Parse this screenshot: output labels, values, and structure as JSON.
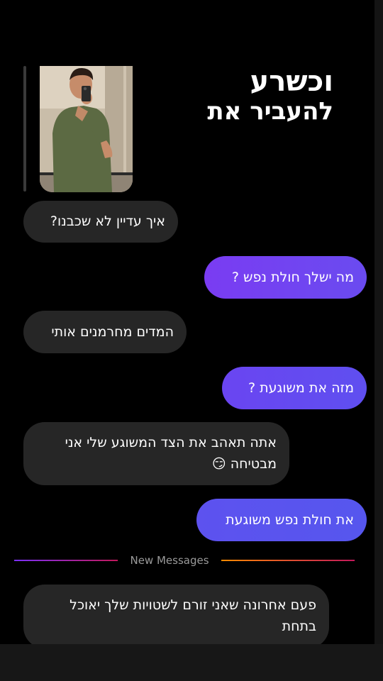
{
  "story": {
    "caption_line1": "וכשרע",
    "caption_line2": "להעביר את"
  },
  "messages": [
    {
      "direction": "incoming",
      "text": "איך עדיין לא שכבנו?"
    },
    {
      "direction": "outgoing",
      "text": "מה ישלך חולת נפש ?"
    },
    {
      "direction": "incoming",
      "text": "המדים מחרמנים אותי"
    },
    {
      "direction": "outgoing",
      "text": "מזה את משוגעת ?"
    },
    {
      "direction": "incoming",
      "text_line1": "אתה תאהב את הצד המשוגע שלי אני",
      "text_line2": "מבטיחה",
      "emoji": "😏"
    },
    {
      "direction": "outgoing",
      "text": "את חולת נפש משוגעת"
    },
    {
      "direction": "incoming",
      "text_line1": "פעם אחרונה שאני זורם לשטויות שלך יאוכל",
      "text_line2": "בתחת"
    }
  ],
  "divider": {
    "label": "New Messages"
  },
  "colors": {
    "incoming_bubble": "#262626",
    "outgoing_gradient_start": "#7a3cf2",
    "outgoing_gradient_end": "#5a55ee",
    "background": "#000000"
  }
}
